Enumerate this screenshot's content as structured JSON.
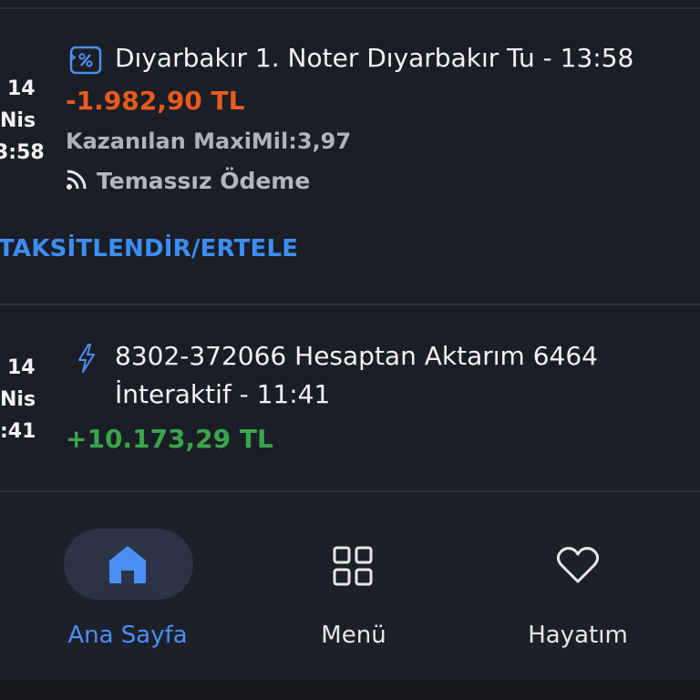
{
  "transactions": [
    {
      "date_day": "14",
      "date_month": "Nis",
      "date_time": "3:58",
      "description": "Dıyarbakır 1. Noter Dıyarbakır Tu - 13:58",
      "amount": "-1.982,90 TL",
      "maximil": "Kazanılan MaxiMil:3,97",
      "payment_type": "Temassız Ödeme",
      "action_link": "TAKSİTLENDİR/ERTELE",
      "icon": "discount-receipt-icon"
    },
    {
      "date_day": "14",
      "date_month": "Nis",
      "date_time": ":41",
      "description_line1": "8302-372066 Hesaptan Aktarım 6464",
      "description_line2": "İnteraktif - 11:41",
      "amount": "+10.173,29 TL",
      "icon": "lightning-icon"
    }
  ],
  "nav": {
    "items": [
      {
        "label": "Ana Sayfa",
        "icon": "home-icon",
        "active": true
      },
      {
        "label": "Menü",
        "icon": "grid-icon",
        "active": false
      },
      {
        "label": "Hayatım",
        "icon": "heart-icon",
        "active": false
      }
    ]
  },
  "colors": {
    "negative": "#ea5a1e",
    "positive": "#3aa54a",
    "accent": "#3d8ef2"
  }
}
